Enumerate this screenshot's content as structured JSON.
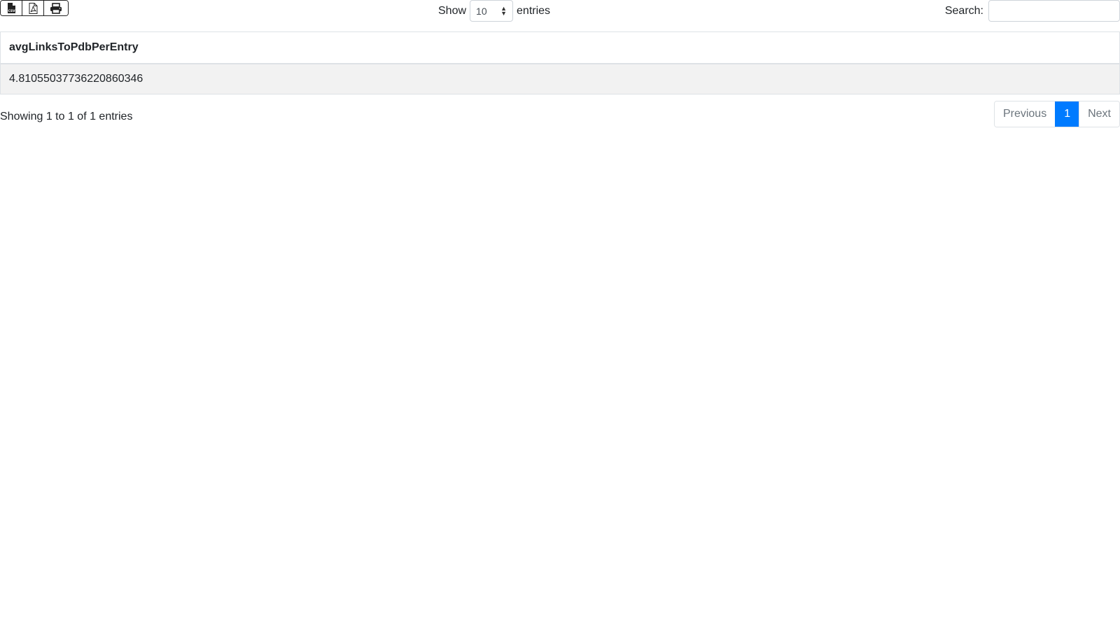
{
  "toolbar": {
    "export_buttons": [
      {
        "icon": "csv-file-icon"
      },
      {
        "icon": "pdf-file-icon"
      },
      {
        "icon": "print-icon"
      }
    ],
    "length": {
      "show_label": "Show",
      "selected": "10",
      "entries_label": "entries"
    },
    "search": {
      "label": "Search:",
      "value": "",
      "placeholder": ""
    }
  },
  "table": {
    "columns": [
      "avgLinksToPdbPerEntry"
    ],
    "rows": [
      [
        "4.81055037736220860346"
      ]
    ]
  },
  "footer": {
    "info": "Showing 1 to 1 of 1 entries",
    "pagination": {
      "previous": "Previous",
      "current": "1",
      "next": "Next"
    }
  },
  "colors": {
    "accent": "#007bff",
    "row_stripe": "#f2f2f2"
  }
}
